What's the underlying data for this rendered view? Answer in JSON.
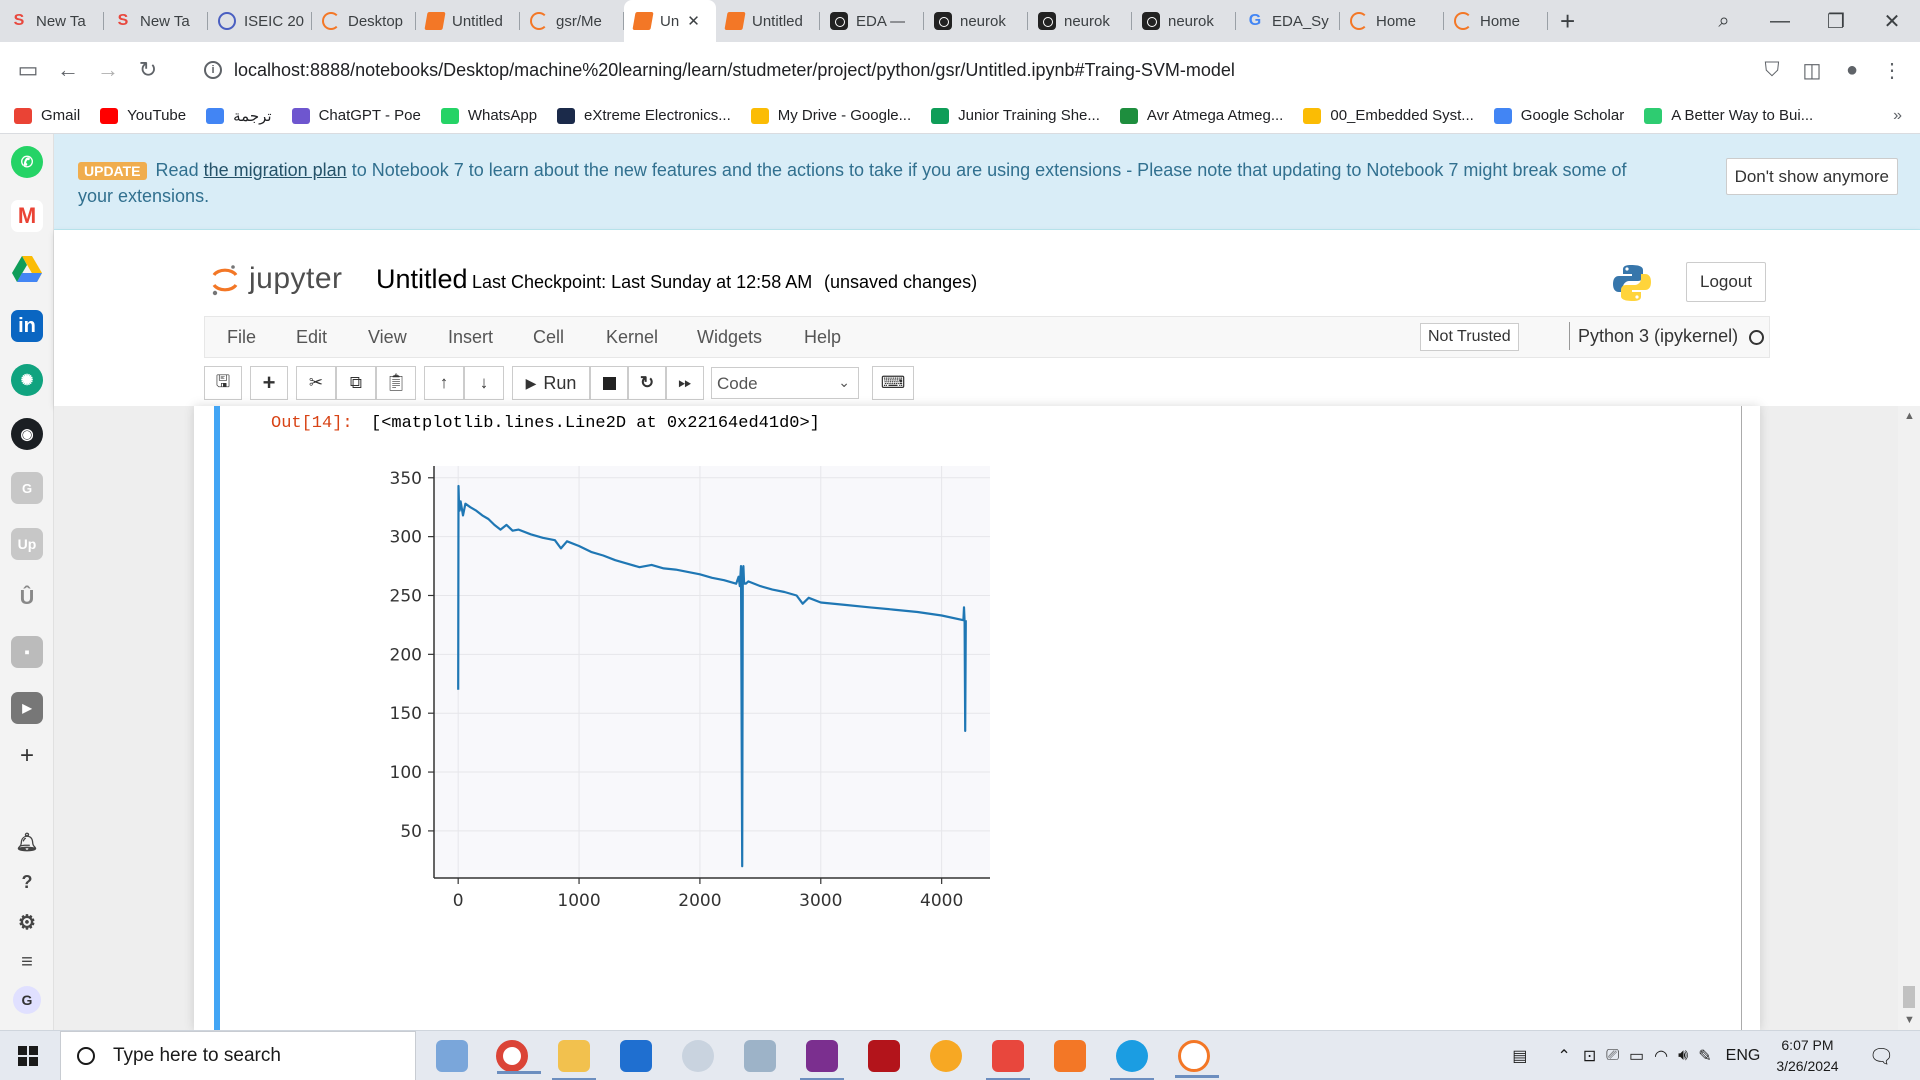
{
  "browser": {
    "tabs": [
      {
        "label": "New Ta",
        "icon": "s-logo-icon",
        "active": false
      },
      {
        "label": "New Ta",
        "icon": "s-logo-icon",
        "active": false
      },
      {
        "label": "ISEIC 20",
        "icon": "globe-icon",
        "active": false
      },
      {
        "label": "Desktop",
        "icon": "jupyter-ring-icon",
        "active": false
      },
      {
        "label": "Untitled",
        "icon": "notebook-icon",
        "active": false
      },
      {
        "label": "gsr/Me",
        "icon": "jupyter-ring-icon",
        "active": false
      },
      {
        "label": "Un",
        "icon": "notebook-icon",
        "active": true
      },
      {
        "label": "Untitled",
        "icon": "notebook-icon",
        "active": false
      },
      {
        "label": "EDA —",
        "icon": "camera-icon",
        "active": false
      },
      {
        "label": "neurok",
        "icon": "camera-icon",
        "active": false
      },
      {
        "label": "neurok",
        "icon": "camera-icon",
        "active": false
      },
      {
        "label": "neurok",
        "icon": "camera-icon",
        "active": false
      },
      {
        "label": "EDA_Sy",
        "icon": "google-g-icon",
        "active": false
      },
      {
        "label": "Home",
        "icon": "jupyter-ring-icon",
        "active": false
      },
      {
        "label": "Home",
        "icon": "jupyter-ring-icon",
        "active": false
      }
    ],
    "url": "localhost:8888/notebooks/Desktop/machine%20learning/learn/studmeter/project/python/gsr/Untitled.ipynb#Traing-SVM-model",
    "bookmarks": [
      {
        "label": "Gmail",
        "color": "#ea4335"
      },
      {
        "label": "YouTube",
        "color": "#ff0000"
      },
      {
        "label": "ترجمة",
        "color": "#4285f4"
      },
      {
        "label": "ChatGPT - Poe",
        "color": "#6e56cf"
      },
      {
        "label": "WhatsApp",
        "color": "#25d366"
      },
      {
        "label": "eXtreme Electronics...",
        "color": "#1b2a4a"
      },
      {
        "label": "My Drive - Google...",
        "color": "#fbbc04"
      },
      {
        "label": "Junior Training She...",
        "color": "#0f9d58"
      },
      {
        "label": "Avr Atmega Atmeg...",
        "color": "#1e8e3e"
      },
      {
        "label": "00_Embedded Syst...",
        "color": "#fbbc04"
      },
      {
        "label": "Google Scholar",
        "color": "#4285f4"
      },
      {
        "label": "A Better Way to Bui...",
        "color": "#2ecc71"
      }
    ]
  },
  "banner": {
    "badge": "UPDATE",
    "text_before": "Read ",
    "link": "the migration plan",
    "text_after": " to Notebook 7 to learn about the new features and the actions to take if you are using extensions - Please note that updating to Notebook 7 might break some of your extensions.",
    "dismiss_label": "Don't show anymore"
  },
  "jupyter": {
    "logo_text": "jupyter",
    "notebook_title": "Untitled",
    "checkpoint": "Last Checkpoint: Last Sunday at 12:58 AM",
    "unsaved": "(unsaved changes)",
    "logout_label": "Logout",
    "menu": [
      "File",
      "Edit",
      "View",
      "Insert",
      "Cell",
      "Kernel",
      "Widgets",
      "Help"
    ],
    "trust_label": "Not Trusted",
    "kernel_label": "Python 3 (ipykernel)",
    "run_label": "Run",
    "cell_type": "Code"
  },
  "output": {
    "prompt": "Out[14]:",
    "text": "[<matplotlib.lines.Line2D at 0x22164ed41d0>]"
  },
  "chart_data": {
    "type": "line",
    "title": "",
    "xlabel": "",
    "ylabel": "",
    "xlim": [
      -200,
      4400
    ],
    "ylim": [
      10,
      360
    ],
    "xticks": [
      0,
      1000,
      2000,
      3000,
      4000
    ],
    "yticks": [
      50,
      100,
      150,
      200,
      250,
      300,
      350
    ],
    "grid": true,
    "line_color": "#1f77b4",
    "series": [
      {
        "x": [
          0,
          3,
          8,
          12,
          20,
          40,
          60,
          100,
          150,
          200,
          250,
          300,
          350,
          400,
          450,
          500,
          600,
          700,
          800,
          850,
          900,
          1000,
          1100,
          1200,
          1300,
          1400,
          1500,
          1600,
          1700,
          1800,
          1900,
          2000,
          2100,
          2200,
          2300,
          2320,
          2330,
          2340,
          2350,
          2355,
          2360,
          2365,
          2370,
          2380,
          2400,
          2500,
          2600,
          2700,
          2800,
          2850,
          2900,
          3000,
          3200,
          3400,
          3600,
          3800,
          4000,
          4180,
          4185,
          4190,
          4195,
          4200
        ],
        "y": [
          170,
          343,
          325,
          322,
          330,
          318,
          328,
          325,
          322,
          318,
          315,
          310,
          306,
          310,
          305,
          306,
          302,
          299,
          297,
          290,
          296,
          292,
          287,
          284,
          280,
          277,
          274,
          276,
          273,
          272,
          270,
          268,
          265,
          263,
          260,
          266,
          258,
          275,
          20,
          270,
          275,
          262,
          260,
          260,
          262,
          258,
          255,
          253,
          250,
          243,
          248,
          244,
          242,
          240,
          238,
          236,
          233,
          229,
          240,
          228,
          135,
          229
        ]
      }
    ]
  },
  "taskbar": {
    "search_placeholder": "Type here to search",
    "lang": "ENG",
    "time": "6:07 PM",
    "date": "3/26/2024"
  }
}
